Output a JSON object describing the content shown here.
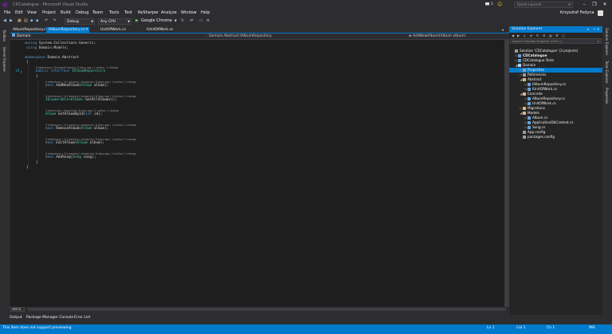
{
  "window": {
    "title": "CDCatalogue - Microsoft Visual Studio",
    "user": "Krzysztof Fedyna",
    "quick_launch": "Quick Launch",
    "notifications": "1"
  },
  "menu": [
    "File",
    "Edit",
    "View",
    "Project",
    "Build",
    "Debug",
    "Team",
    "Tools",
    "Test",
    "ReSharper",
    "Analyze",
    "Window",
    "Help"
  ],
  "toolbar": {
    "configuration": "Debug",
    "platform": "Any CPU",
    "run_target": "Google Chrome"
  },
  "left_tabs": [
    "Toolbox",
    "Server Explorer"
  ],
  "right_tabs": [
    "Solution Explorer",
    "Team Explorer",
    "Properties"
  ],
  "doc_tabs": [
    {
      "label": "AlbumRepository.cs"
    },
    {
      "label": "IAlbumRepository.cs"
    },
    {
      "label": "UnitOfWork.cs"
    },
    {
      "label": "IUnitOfWork.cs"
    }
  ],
  "navbar": {
    "project": "Domain",
    "type": "Domain.Abstract.IAlbumRepository",
    "member": "AddNewAlbum(Album album)"
  },
  "code": {
    "l1_kw": "using",
    "l1_tx": " System.Collections.Generic;",
    "l2_kw": "using",
    "l2_tx": " Domain.Models;",
    "l3_kw": "namespace",
    "l3_tx": " Domain.Abstract",
    "brace_open": "{",
    "lens1": "8 references | Krzysztof Fedyna, 8 days ago | 1 author, 1 change",
    "l5_kw": "public interface",
    "l5_ty": " IAlbumRepository",
    "brace_open2": "{",
    "lens2": "3 references | 1/1 passing | drepsinski, 8 days ago | 1 author, 1 change",
    "m1_ty": "bool",
    "m1_tx": " AddNewAlbum(",
    "m1_ty2": "Album",
    "m1_tx2": " album);",
    "lens3": "4 references | 1/1 passing | drepsinski, 8 days ago | 1 author, 1 change",
    "m2_ty": "IEnumerable<Album>",
    "m2_tx": " GetAllAlbums();",
    "lens4": "3 references | drepsinski, 8 days ago | 1 author, 1 change",
    "m3_ty": "Album",
    "m3_tx": " GetAlbumById(",
    "m3_kw": "int",
    "m3_tx2": " id);",
    "lens5": "3 references | 1/1 passing | drepsinski, 8 days ago | 1 author, 1 change",
    "m4_ty": "bool",
    "m4_tx": " RemoveAlbum(",
    "m4_ty2": "Album",
    "m4_tx2": " album);",
    "lens6": "3 references | 1/1 passing | drepsinski, 8 days ago | 1 author, 1 change",
    "m5_ty": "bool",
    "m5_tx": " EditAlbum(",
    "m5_ty2": "Album",
    "m5_tx2": " album);",
    "lens7": "3 references | 1/1 passing | drepsinski, 8 days ago | 1 author, 1 change",
    "m6_ty": "bool",
    "m6_tx": " AddSong(",
    "m6_ty2": "Song",
    "m6_tx2": " song);",
    "brace_close2": "}",
    "brace_close": "}"
  },
  "gutter_line_number": "10",
  "zoom": "100 %",
  "solution_explorer": {
    "title": "Solution Explorer",
    "search_placeholder": "Search Solution Explorer (Ctrl+;)",
    "nodes": [
      {
        "label": "Solution 'CDCatalogue' (3 projects)",
        "icon": "solution-icon",
        "color": "#9b9b9b"
      },
      {
        "label": "CDCatalogue",
        "icon": "web-project-icon",
        "color": "#68a0d8"
      },
      {
        "label": "CDCatalogue.Tests",
        "icon": "test-project-icon",
        "color": "#68a0d8"
      },
      {
        "label": "Domain",
        "icon": "csharp-project-icon",
        "color": "#68a0d8"
      },
      {
        "label": "Properties",
        "icon": "wrench-icon",
        "color": "#9b9b9b"
      },
      {
        "label": "References",
        "icon": "references-icon",
        "color": "#9b9b9b"
      },
      {
        "label": "Abstract",
        "icon": "folder-icon",
        "color": "#dcb67a"
      },
      {
        "label": "IAlbumRepository.cs",
        "icon": "csharp-file-icon",
        "color": "#68a0d8"
      },
      {
        "label": "IUnitOfWork.cs",
        "icon": "csharp-file-icon",
        "color": "#68a0d8"
      },
      {
        "label": "Concrete",
        "icon": "folder-icon",
        "color": "#dcb67a"
      },
      {
        "label": "AlbumRepository.cs",
        "icon": "csharp-file-icon",
        "color": "#68a0d8"
      },
      {
        "label": "UnitOfWork.cs",
        "icon": "csharp-file-icon",
        "color": "#68a0d8"
      },
      {
        "label": "Migrations",
        "icon": "folder-icon",
        "color": "#dcb67a"
      },
      {
        "label": "Models",
        "icon": "folder-icon",
        "color": "#dcb67a"
      },
      {
        "label": "Album.cs",
        "icon": "csharp-file-icon",
        "color": "#68a0d8"
      },
      {
        "label": "ApplicationDbContext.cs",
        "icon": "csharp-file-icon",
        "color": "#68a0d8"
      },
      {
        "label": "Song.cs",
        "icon": "csharp-file-icon",
        "color": "#68a0d8"
      },
      {
        "label": "App.config",
        "icon": "config-file-icon",
        "color": "#9b9b9b"
      },
      {
        "label": "packages.config",
        "icon": "config-file-icon",
        "color": "#9b9b9b"
      }
    ]
  },
  "bottom_tabs": [
    "Output",
    "Package Manager Console",
    "Error List"
  ],
  "status": {
    "message": "This item does not support previewing",
    "ln": "Ln 1",
    "col": "Col 1",
    "ch": "Ch 1",
    "mode": "INS"
  },
  "colors": {
    "accent": "#007acc",
    "editor_bg": "#1e1e1e",
    "chrome_bg": "#2d2d30"
  }
}
